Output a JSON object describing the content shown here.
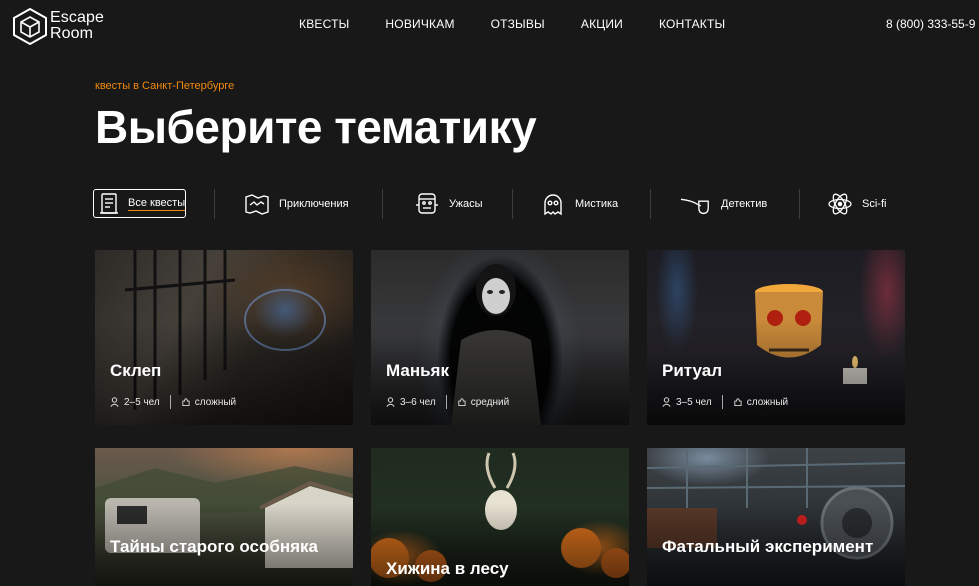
{
  "header": {
    "logo_line1": "Escape",
    "logo_line2": "Room",
    "nav": [
      "КВЕСТЫ",
      "НОВИЧКАМ",
      "ОТЗЫВЫ",
      "АКЦИИ",
      "КОНТАКТЫ"
    ],
    "phone": "8 (800) 333-55-9"
  },
  "breadcrumb": "квесты в Санкт-Петербурге",
  "title": "Выберите тематику",
  "filters": [
    {
      "label": "Все квесты",
      "icon": "all-quests-icon",
      "active": true
    },
    {
      "label": "Приключения",
      "icon": "map-icon",
      "active": false
    },
    {
      "label": "Ужасы",
      "icon": "frankenstein-icon",
      "active": false
    },
    {
      "label": "Мистика",
      "icon": "ghost-skull-icon",
      "active": false
    },
    {
      "label": "Детектив",
      "icon": "pipe-icon",
      "active": false
    },
    {
      "label": "Sci-fi",
      "icon": "atom-icon",
      "active": false
    }
  ],
  "cards": [
    {
      "name": "Склеп",
      "players": "2–5 чел",
      "level": "сложный"
    },
    {
      "name": "Маньяк",
      "players": "3–6 чел",
      "level": "средний"
    },
    {
      "name": "Ритуал",
      "players": "3–5 чел",
      "level": "сложный"
    },
    {
      "name": "Тайны старого особняка"
    },
    {
      "name": "Хижина в лесу"
    },
    {
      "name": "Фатальный эксперимент"
    }
  ],
  "colors": {
    "background": "#181818",
    "accent": "#f2890d",
    "text": "#ffffff"
  }
}
